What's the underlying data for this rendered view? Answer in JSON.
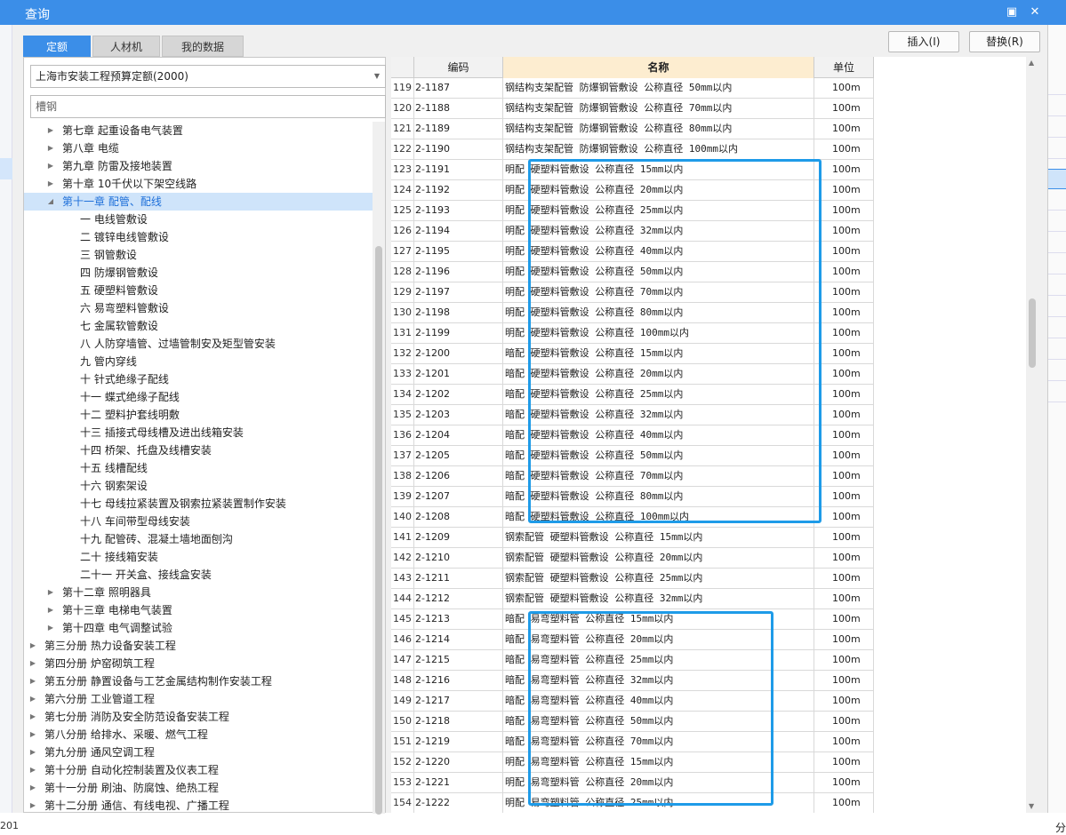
{
  "window": {
    "title": "查询"
  },
  "controls": {
    "restore_icon": "restore-icon",
    "close_icon": "close-icon"
  },
  "tabs": [
    {
      "label": "定额",
      "active": true
    },
    {
      "label": "人材机",
      "active": false
    },
    {
      "label": "我的数据",
      "active": false
    }
  ],
  "buttons": {
    "insert": "插入(I)",
    "replace": "替换(R)"
  },
  "library": {
    "selected": "上海市安装工程预算定额(2000)"
  },
  "search": {
    "value": "槽钢"
  },
  "background": {
    "left_year": "201",
    "right_char": "分"
  },
  "tree": [
    {
      "label": "第七章 起重设备电气装置",
      "level": 1,
      "expander": "collapsed"
    },
    {
      "label": "第八章 电缆",
      "level": 1,
      "expander": "collapsed"
    },
    {
      "label": "第九章 防雷及接地装置",
      "level": 1,
      "expander": "collapsed"
    },
    {
      "label": "第十章 10千伏以下架空线路",
      "level": 1,
      "expander": "collapsed"
    },
    {
      "label": "第十一章 配管、配线",
      "level": 1,
      "expander": "expanded",
      "selected": true
    },
    {
      "label": "一 电线管敷设",
      "level": 2
    },
    {
      "label": "二 镀锌电线管敷设",
      "level": 2
    },
    {
      "label": "三 钢管敷设",
      "level": 2
    },
    {
      "label": "四 防爆钢管敷设",
      "level": 2
    },
    {
      "label": "五 硬塑料管敷设",
      "level": 2
    },
    {
      "label": "六 易弯塑料管敷设",
      "level": 2
    },
    {
      "label": "七 金属软管敷设",
      "level": 2
    },
    {
      "label": "八 人防穿墙管、过墙管制安及矩型管安装",
      "level": 2
    },
    {
      "label": "九 管内穿线",
      "level": 2
    },
    {
      "label": "十 针式绝缘子配线",
      "level": 2
    },
    {
      "label": "十一 蝶式绝缘子配线",
      "level": 2
    },
    {
      "label": "十二 塑料护套线明敷",
      "level": 2
    },
    {
      "label": "十三 插接式母线槽及进出线箱安装",
      "level": 2
    },
    {
      "label": "十四 桥架、托盘及线槽安装",
      "level": 2
    },
    {
      "label": "十五 线槽配线",
      "level": 2
    },
    {
      "label": "十六 钢索架设",
      "level": 2
    },
    {
      "label": "十七 母线拉紧装置及钢索拉紧装置制作安装",
      "level": 2
    },
    {
      "label": "十八 车间带型母线安装",
      "level": 2
    },
    {
      "label": "十九 配管砖、混凝土墙地面刨沟",
      "level": 2
    },
    {
      "label": "二十 接线箱安装",
      "level": 2
    },
    {
      "label": "二十一 开关盒、接线盒安装",
      "level": 2
    },
    {
      "label": "第十二章 照明器具",
      "level": 1,
      "expander": "collapsed"
    },
    {
      "label": "第十三章 电梯电气装置",
      "level": 1,
      "expander": "collapsed"
    },
    {
      "label": "第十四章 电气调整试验",
      "level": 1,
      "expander": "collapsed"
    },
    {
      "label": "第三分册 热力设备安装工程",
      "level": 0,
      "expander": "collapsed"
    },
    {
      "label": "第四分册 炉窑砌筑工程",
      "level": 0,
      "expander": "collapsed"
    },
    {
      "label": "第五分册 静置设备与工艺金属结构制作安装工程",
      "level": 0,
      "expander": "collapsed"
    },
    {
      "label": "第六分册 工业管道工程",
      "level": 0,
      "expander": "collapsed"
    },
    {
      "label": "第七分册 消防及安全防范设备安装工程",
      "level": 0,
      "expander": "collapsed"
    },
    {
      "label": "第八分册 给排水、采暖、燃气工程",
      "level": 0,
      "expander": "collapsed"
    },
    {
      "label": "第九分册 通风空调工程",
      "level": 0,
      "expander": "collapsed"
    },
    {
      "label": "第十分册 自动化控制装置及仪表工程",
      "level": 0,
      "expander": "collapsed"
    },
    {
      "label": "第十一分册 刷油、防腐蚀、绝热工程",
      "level": 0,
      "expander": "collapsed"
    },
    {
      "label": "第十二分册 通信、有线电视、广播工程",
      "level": 0,
      "expander": "collapsed"
    }
  ],
  "grid": {
    "columns": {
      "index": "",
      "code": "编码",
      "name": "名称",
      "unit": "单位"
    },
    "rows": [
      {
        "idx": "119",
        "code": "2-1187",
        "name": "钢结构支架配管 防爆钢管敷设 公称直径 50mm以内",
        "unit": "100m"
      },
      {
        "idx": "120",
        "code": "2-1188",
        "name": "钢结构支架配管 防爆钢管敷设 公称直径 70mm以内",
        "unit": "100m"
      },
      {
        "idx": "121",
        "code": "2-1189",
        "name": "钢结构支架配管 防爆钢管敷设 公称直径 80mm以内",
        "unit": "100m"
      },
      {
        "idx": "122",
        "code": "2-1190",
        "name": "钢结构支架配管 防爆钢管敷设 公称直径 100mm以内",
        "unit": "100m"
      },
      {
        "idx": "123",
        "code": "2-1191",
        "name": "明配 硬塑料管敷设 公称直径 15mm以内",
        "unit": "100m"
      },
      {
        "idx": "124",
        "code": "2-1192",
        "name": "明配 硬塑料管敷设 公称直径 20mm以内",
        "unit": "100m"
      },
      {
        "idx": "125",
        "code": "2-1193",
        "name": "明配 硬塑料管敷设 公称直径 25mm以内",
        "unit": "100m"
      },
      {
        "idx": "126",
        "code": "2-1194",
        "name": "明配 硬塑料管敷设 公称直径 32mm以内",
        "unit": "100m"
      },
      {
        "idx": "127",
        "code": "2-1195",
        "name": "明配 硬塑料管敷设 公称直径 40mm以内",
        "unit": "100m"
      },
      {
        "idx": "128",
        "code": "2-1196",
        "name": "明配 硬塑料管敷设 公称直径 50mm以内",
        "unit": "100m"
      },
      {
        "idx": "129",
        "code": "2-1197",
        "name": "明配 硬塑料管敷设 公称直径 70mm以内",
        "unit": "100m"
      },
      {
        "idx": "130",
        "code": "2-1198",
        "name": "明配 硬塑料管敷设 公称直径 80mm以内",
        "unit": "100m"
      },
      {
        "idx": "131",
        "code": "2-1199",
        "name": "明配 硬塑料管敷设 公称直径 100mm以内",
        "unit": "100m"
      },
      {
        "idx": "132",
        "code": "2-1200",
        "name": "暗配 硬塑料管敷设 公称直径 15mm以内",
        "unit": "100m"
      },
      {
        "idx": "133",
        "code": "2-1201",
        "name": "暗配 硬塑料管敷设 公称直径 20mm以内",
        "unit": "100m"
      },
      {
        "idx": "134",
        "code": "2-1202",
        "name": "暗配 硬塑料管敷设 公称直径 25mm以内",
        "unit": "100m"
      },
      {
        "idx": "135",
        "code": "2-1203",
        "name": "暗配 硬塑料管敷设 公称直径 32mm以内",
        "unit": "100m"
      },
      {
        "idx": "136",
        "code": "2-1204",
        "name": "暗配 硬塑料管敷设 公称直径 40mm以内",
        "unit": "100m"
      },
      {
        "idx": "137",
        "code": "2-1205",
        "name": "暗配 硬塑料管敷设 公称直径 50mm以内",
        "unit": "100m"
      },
      {
        "idx": "138",
        "code": "2-1206",
        "name": "暗配 硬塑料管敷设 公称直径 70mm以内",
        "unit": "100m"
      },
      {
        "idx": "139",
        "code": "2-1207",
        "name": "暗配 硬塑料管敷设 公称直径 80mm以内",
        "unit": "100m"
      },
      {
        "idx": "140",
        "code": "2-1208",
        "name": "暗配 硬塑料管敷设 公称直径 100mm以内",
        "unit": "100m"
      },
      {
        "idx": "141",
        "code": "2-1209",
        "name": "钢索配管 硬塑料管敷设 公称直径 15mm以内",
        "unit": "100m"
      },
      {
        "idx": "142",
        "code": "2-1210",
        "name": "钢索配管 硬塑料管敷设 公称直径 20mm以内",
        "unit": "100m"
      },
      {
        "idx": "143",
        "code": "2-1211",
        "name": "钢索配管 硬塑料管敷设 公称直径 25mm以内",
        "unit": "100m"
      },
      {
        "idx": "144",
        "code": "2-1212",
        "name": "钢索配管 硬塑料管敷设 公称直径 32mm以内",
        "unit": "100m"
      },
      {
        "idx": "145",
        "code": "2-1213",
        "name": "暗配 易弯塑料管 公称直径 15mm以内",
        "unit": "100m"
      },
      {
        "idx": "146",
        "code": "2-1214",
        "name": "暗配 易弯塑料管 公称直径 20mm以内",
        "unit": "100m"
      },
      {
        "idx": "147",
        "code": "2-1215",
        "name": "暗配 易弯塑料管 公称直径 25mm以内",
        "unit": "100m"
      },
      {
        "idx": "148",
        "code": "2-1216",
        "name": "暗配 易弯塑料管 公称直径 32mm以内",
        "unit": "100m"
      },
      {
        "idx": "149",
        "code": "2-1217",
        "name": "暗配 易弯塑料管 公称直径 40mm以内",
        "unit": "100m"
      },
      {
        "idx": "150",
        "code": "2-1218",
        "name": "暗配 易弯塑料管 公称直径 50mm以内",
        "unit": "100m"
      },
      {
        "idx": "151",
        "code": "2-1219",
        "name": "暗配 易弯塑料管 公称直径 70mm以内",
        "unit": "100m"
      },
      {
        "idx": "152",
        "code": "2-1220",
        "name": "明配 易弯塑料管 公称直径 15mm以内",
        "unit": "100m"
      },
      {
        "idx": "153",
        "code": "2-1221",
        "name": "明配 易弯塑料管 公称直径 20mm以内",
        "unit": "100m"
      },
      {
        "idx": "154",
        "code": "2-1222",
        "name": "明配 易弯塑料管 公称直径 25mm以内",
        "unit": "100m"
      }
    ]
  },
  "highlight_color": "#1e9be8",
  "accent_color": "#3b8ee8"
}
